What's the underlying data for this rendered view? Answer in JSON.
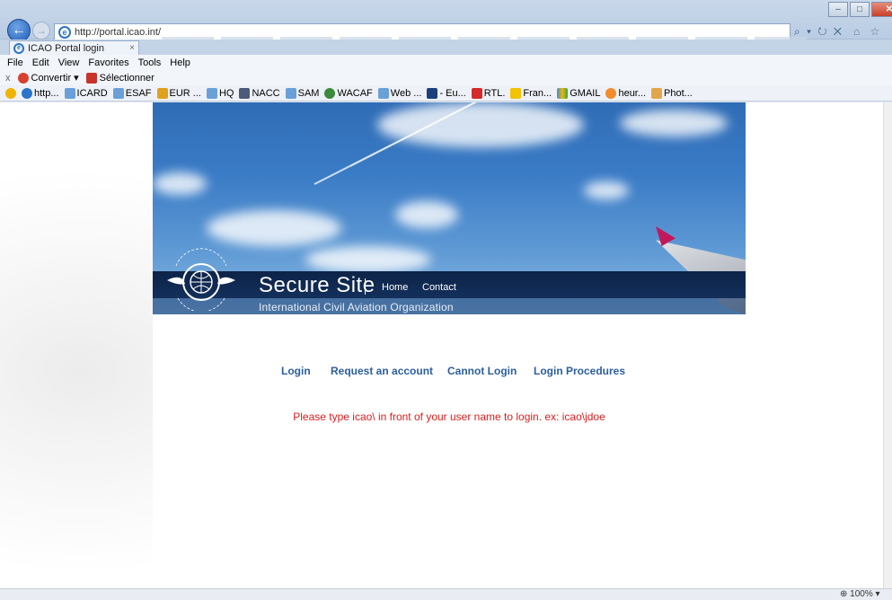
{
  "browser": {
    "url": "http://portal.icao.int/",
    "tab_title": "ICAO Portal login",
    "tab_close": "×",
    "back_glyph": "←",
    "forward_glyph": "→",
    "addr_controls": "⌕ ▾ ↻ ✕",
    "right_icons": "⌂ ☆ ⚙",
    "window_buttons": {
      "minimize": "‒",
      "maximize": "□",
      "close": "✕"
    },
    "menu": [
      "File",
      "Edit",
      "View",
      "Favorites",
      "Tools",
      "Help"
    ],
    "command_bar": {
      "close": "x",
      "convert": "Convertir",
      "select": "Sélectionner"
    },
    "favorites": [
      "http...",
      "ICARD",
      "ESAF",
      "EUR ...",
      "HQ",
      "NACC",
      "SAM",
      "WACAF",
      "Web ...",
      "- Eu...",
      "RTL.",
      "Fran...",
      "GMAIL",
      "heur...",
      "Phot..."
    ],
    "zoom": "100%",
    "zoom_arrow": "▾"
  },
  "site": {
    "title": "Secure Site",
    "org": "International Civil Aviation Organization",
    "nav": {
      "home": "Home",
      "contact": "Contact"
    },
    "links": [
      "Login",
      "Request an account",
      "Cannot Login",
      "Login Procedures"
    ],
    "notice": "Please type icao\\ in front of your user name to login. ex: icao\\jdoe"
  },
  "colors": {
    "link": "#2c5f9e",
    "notice": "#e01b1b",
    "band": "#0d2347"
  }
}
